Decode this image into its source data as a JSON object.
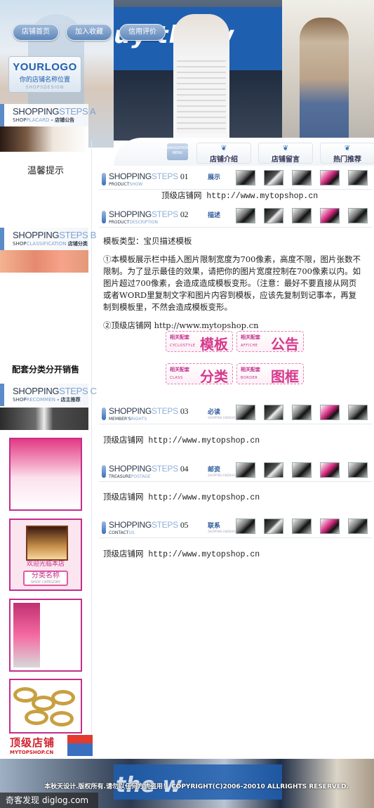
{
  "header": {
    "nav": [
      "店铺首页",
      "加入收藏",
      "信用评价"
    ],
    "logo": {
      "title": "YOURLOGO",
      "subtitle": "你的店铺名称位置",
      "small": "SHOPSDESIGN"
    },
    "photo_sign_text": "uy the w",
    "nav_mini": "NAVIGATION MENU",
    "tabs": [
      "店铺介绍",
      "店铺留言",
      "热门推荐"
    ]
  },
  "sidebar": {
    "step_a": {
      "t1a": "SHOPPING",
      "t1b": "STEPS A",
      "t2a": "SHOP",
      "t2b": "PLACARD",
      "t2c": " - 店铺公告"
    },
    "notice_title": "温馨提示",
    "step_b": {
      "t1a": "SHOPPING",
      "t1b": "STEPS B",
      "t2a": "SHOP",
      "t2b": "CLASSIFICATION",
      "t2c": " 店铺分类"
    },
    "matching_title": "配套分类分开销售",
    "step_c": {
      "t1a": "SHOPPING",
      "t1b": "STEPS C",
      "t2a": "SHOP",
      "t2b": "RECOMMEN",
      "t2c": " - 店主推荐"
    },
    "rec2": {
      "welcome": "欢迎光临本店",
      "category": "分类名称",
      "category_small": "SHOP CATEGORY"
    },
    "footer_logo": {
      "name": "顶级店铺",
      "url": "MYTOPSHOP.CN"
    }
  },
  "sections": [
    {
      "num": "01",
      "en": "PRODUCT",
      "en2": "SHOW",
      "cn": "展示",
      "text": "顶级店铺网  http://www.mytopshop.cn"
    },
    {
      "num": "02",
      "en": "PRODUCT",
      "en2": "DESCRIPTION",
      "cn": "描述"
    },
    {
      "num": "03",
      "en": "MEMBER'S",
      "en2": "RIGHTS",
      "cn": "必读",
      "text": "顶级店铺网  http://www.mytopshop.cn"
    },
    {
      "num": "04",
      "en": "TREASURE",
      "en2": "POSTAGE",
      "cn": "邮资",
      "text": "顶级店铺网  http://www.mytopshop.cn"
    },
    {
      "num": "05",
      "en": "CONTACT",
      "en2": "US",
      "cn": "联系",
      "text": "顶级店铺网  http://www.mytopshop.cn"
    }
  ],
  "section_title": {
    "a": "SHOPPING",
    "b": "STEPS"
  },
  "section_small": "SHOPPING ENDSHOP",
  "description": {
    "type_line": "模板类型：宝贝描述模板",
    "para1": "①本模板展示栏中插入图片限制宽度为700像素，高度不限，图片张数不限制。为了显示最佳的效果，请把你的图片宽度控制在700像素以内。如图片超过700像素，会造成造成模板变形。（注意：最好不要直接从网页或者WORD里复制文字和图片内容到模板，应该先复制到记事本，再复制到模板里，不然会造成模板变形。",
    "para2": "②顶级店铺网 http://www.mytopshop.cn"
  },
  "template_buttons": [
    {
      "small": "相关配套",
      "en": "CYCLOSTYLE",
      "big": "模板"
    },
    {
      "small": "相关配套",
      "en": "AFFICHE",
      "big": "公告"
    },
    {
      "small": "相关配套",
      "en": "CLASS",
      "big": "分类"
    },
    {
      "small": "相关配套",
      "en": "BORDER",
      "big": "图框"
    }
  ],
  "footer": {
    "sign_text": "the w",
    "copyright": "本秋天设计.版权所有.请勿以任何方式盗用！     COPYRIGHT(C)2006-20010 ALLRIGHTS RESERVED."
  },
  "watermark": "奇客发现 diglog.com",
  "colors": {
    "accent_blue": "#3a6fb8",
    "accent_pink": "#c42e8c",
    "logo_red": "#d0212c"
  }
}
